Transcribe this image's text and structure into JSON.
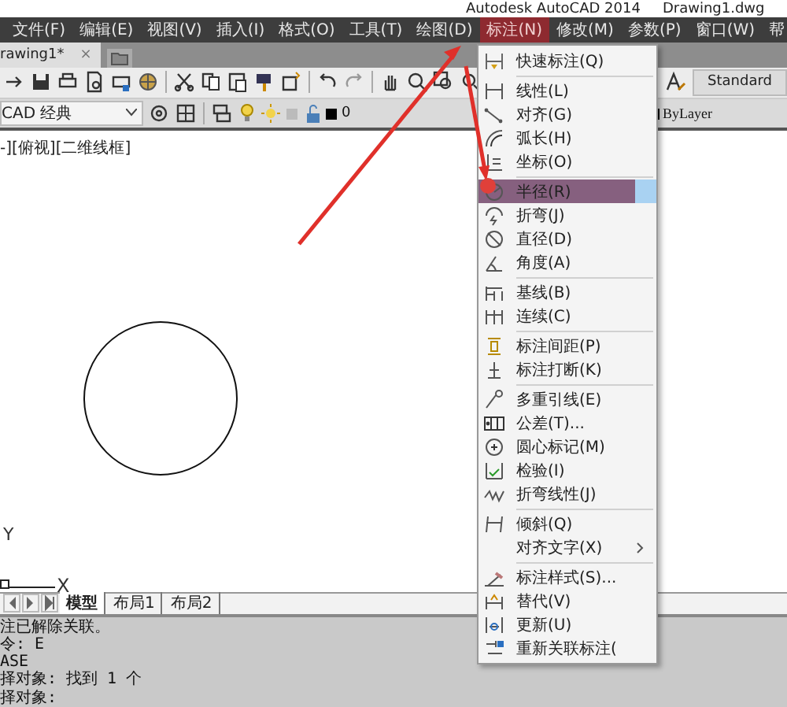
{
  "title_bar": {
    "app": "Autodesk AutoCAD 2014",
    "document": "Drawing1.dwg"
  },
  "menu_bar": [
    {
      "label": "文件(F)",
      "selected": false
    },
    {
      "label": "编辑(E)",
      "selected": false
    },
    {
      "label": "视图(V)",
      "selected": false
    },
    {
      "label": "插入(I)",
      "selected": false
    },
    {
      "label": "格式(O)",
      "selected": false
    },
    {
      "label": "工具(T)",
      "selected": false
    },
    {
      "label": "绘图(D)",
      "selected": false
    },
    {
      "label": "标注(N)",
      "selected": true
    },
    {
      "label": "修改(M)",
      "selected": false
    },
    {
      "label": "参数(P)",
      "selected": false
    },
    {
      "label": "窗口(W)",
      "selected": false
    },
    {
      "label": "帮",
      "selected": false
    }
  ],
  "document_tabs": [
    {
      "label": "rawing1*",
      "close": "×",
      "selected": true
    }
  ],
  "toolbar": {
    "text_style": "Standard"
  },
  "properties_bar": {
    "workspace": "CAD 经典",
    "layer": "0",
    "linetype": "ByLayer"
  },
  "viewport_label": "-][俯视][二维线框]",
  "ucs": {
    "y_label": "Y",
    "x_label": "X"
  },
  "layout_tabs": [
    {
      "label": "模型",
      "selected": true
    },
    {
      "label": "布局1",
      "selected": false
    },
    {
      "label": "布局2",
      "selected": false
    }
  ],
  "command_history": [
    "注已解除关联。",
    "令: E",
    "ASE",
    "择对象: 找到 1 个",
    "择对象:"
  ],
  "dimension_menu": {
    "groups": [
      {
        "items": [
          {
            "label": "快速标注(Q)",
            "selected": false,
            "submenu": false
          }
        ]
      },
      {
        "items": [
          {
            "label": "线性(L)",
            "selected": false,
            "submenu": false
          },
          {
            "label": "对齐(G)",
            "selected": false,
            "submenu": false
          },
          {
            "label": "弧长(H)",
            "selected": false,
            "submenu": false
          },
          {
            "label": "坐标(O)",
            "selected": false,
            "submenu": false
          }
        ]
      },
      {
        "items": [
          {
            "label": "半径(R)",
            "selected": true,
            "submenu": false
          },
          {
            "label": "折弯(J)",
            "selected": false,
            "submenu": false
          },
          {
            "label": "直径(D)",
            "selected": false,
            "submenu": false
          },
          {
            "label": "角度(A)",
            "selected": false,
            "submenu": false
          }
        ]
      },
      {
        "items": [
          {
            "label": "基线(B)",
            "selected": false,
            "submenu": false
          },
          {
            "label": "连续(C)",
            "selected": false,
            "submenu": false
          }
        ]
      },
      {
        "items": [
          {
            "label": "标注间距(P)",
            "selected": false,
            "submenu": false
          },
          {
            "label": "标注打断(K)",
            "selected": false,
            "submenu": false
          }
        ]
      },
      {
        "items": [
          {
            "label": "多重引线(E)",
            "selected": false,
            "submenu": false
          },
          {
            "label": "公差(T)...",
            "selected": false,
            "submenu": false
          },
          {
            "label": "圆心标记(M)",
            "selected": false,
            "submenu": false
          },
          {
            "label": "检验(I)",
            "selected": false,
            "submenu": false
          },
          {
            "label": "折弯线性(J)",
            "selected": false,
            "submenu": false
          }
        ]
      },
      {
        "items": [
          {
            "label": "倾斜(Q)",
            "selected": false,
            "submenu": false
          },
          {
            "label": "对齐文字(X)",
            "selected": false,
            "submenu": true
          }
        ]
      },
      {
        "items": [
          {
            "label": "标注样式(S)...",
            "selected": false,
            "submenu": false
          },
          {
            "label": "替代(V)",
            "selected": false,
            "submenu": false
          },
          {
            "label": "更新(U)",
            "selected": false,
            "submenu": false
          },
          {
            "label": "重新关联标注(",
            "selected": false,
            "submenu": false
          }
        ]
      }
    ]
  }
}
